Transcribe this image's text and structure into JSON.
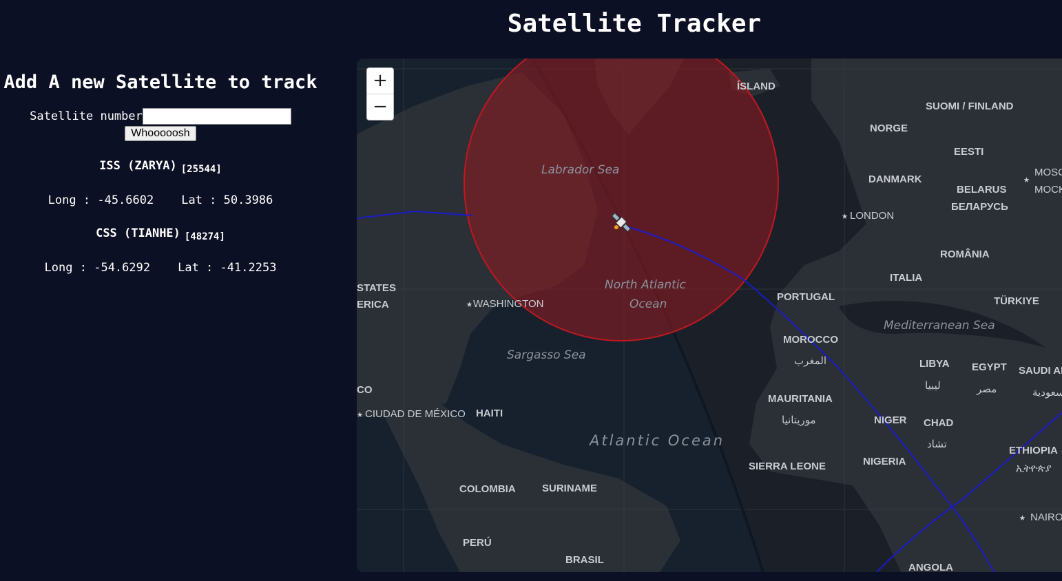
{
  "page": {
    "title": "Satellite Tracker"
  },
  "form": {
    "heading": "Add A new Satellite to track",
    "label": "Satellite number",
    "input_value": "",
    "button": "Whooooosh"
  },
  "satellites": [
    {
      "name": "ISS (ZARYA)",
      "number": "[25544]",
      "long_label": "Long :",
      "long": "-45.6602",
      "lat_label": "Lat :",
      "lat": "50.3986"
    },
    {
      "name": "CSS (TIANHE)",
      "number": "[48274]",
      "long_label": "Long :",
      "long": "-54.6292",
      "lat_label": "Lat :",
      "lat": "-41.2253"
    }
  ],
  "map": {
    "zoom_in": "+",
    "zoom_out": "−",
    "satellite_icon": "satellite-icon",
    "colors": {
      "coverage": "#8b1a22",
      "track": "#1a1ac8",
      "land": "#2b2f36",
      "water": "#1b2028"
    },
    "labels": {
      "island": "ÍSLAND",
      "finland": "SUOMI / FINLAND",
      "norway": "NORGE",
      "estonia": "EESTI",
      "denmark": "DANMARK",
      "moscow1": "MOSC",
      "moscow2": "МОСК",
      "belarus1": "BELARUS",
      "belarus2": "БЕЛАРУСЬ",
      "london": "LONDON",
      "romania": "ROMÂNIA",
      "italy": "ITALIA",
      "portugal": "PORTUGAL",
      "turkey": "TÜRKIYE",
      "mediterranean": "Mediterranean Sea",
      "morocco1": "MOROCCO",
      "morocco2": "المغرب",
      "libya1": "LIBYA",
      "libya2": "ليبيا",
      "egypt1": "EGYPT",
      "egypt2": "مصر",
      "saudi1": "SAUDI AR",
      "saudi2": "سعودية",
      "mauritania1": "MAURITANIA",
      "mauritania2": "موريتانيا",
      "niger": "NIGER",
      "chad1": "CHAD",
      "chad2": "تشاد",
      "ethiopia1": "ETHIOPIA",
      "ethiopia2": "ኢትዮጵያ",
      "sierra_leone": "SIERRA LEONE",
      "nigeria": "NIGERIA",
      "nairobi": "NAIRO",
      "angola": "ANGOLA",
      "labrador": "Labrador Sea",
      "north_atlantic1": "North Atlantic",
      "north_atlantic2": "Ocean",
      "states": "STATES",
      "america": "ERICA",
      "washington": "WASHINGTON",
      "sargasso": "Sargasso Sea",
      "mexico_frag": "CO",
      "mexico_city": "CIUDAD DE MÉXICO",
      "haiti": "HAITI",
      "atlantic": "Atlantic Ocean",
      "colombia": "COLOMBIA",
      "suriname": "SURINAME",
      "peru": "PERÚ",
      "brasil": "BRASIL"
    }
  }
}
